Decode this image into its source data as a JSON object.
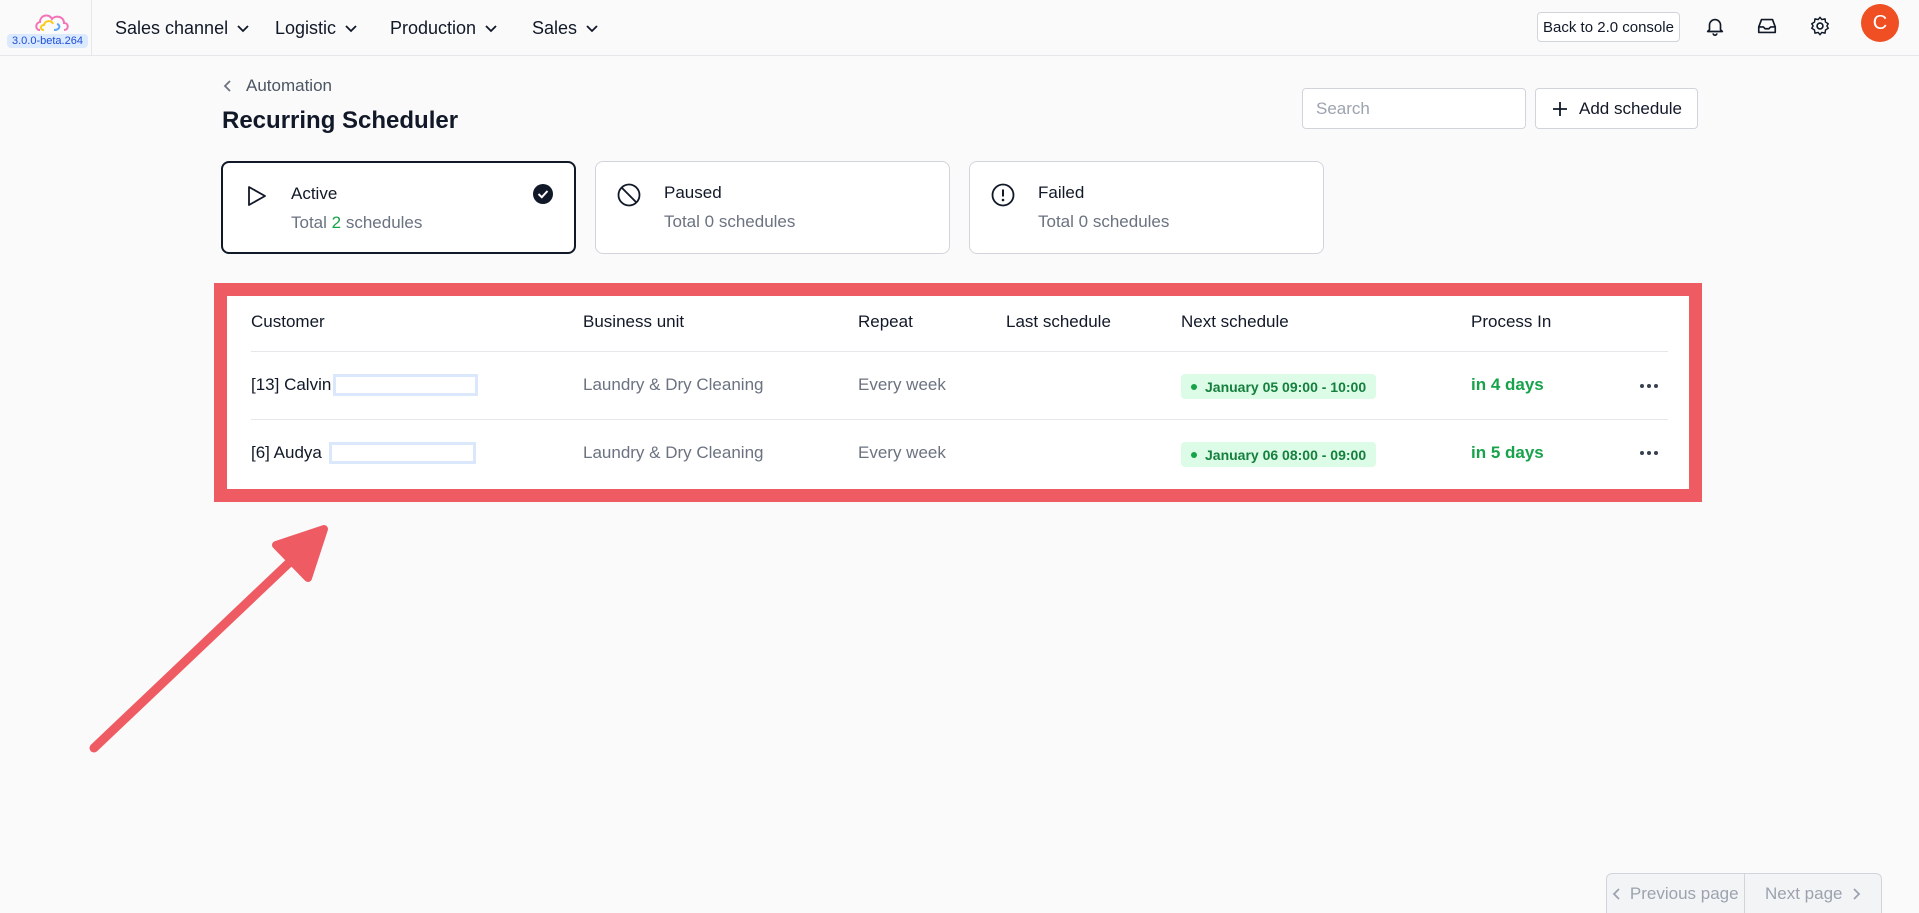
{
  "app": {
    "version": "3.0.0-beta.264",
    "brand_colors": [
      "#f472b6",
      "#facc15",
      "#60a5fa"
    ]
  },
  "nav": {
    "items": [
      {
        "label": "Sales channel"
      },
      {
        "label": "Logistic"
      },
      {
        "label": "Production"
      },
      {
        "label": "Sales"
      }
    ],
    "back_button": "Back to 2.0 console",
    "icons": [
      "bell-icon",
      "inbox-icon",
      "gear-icon"
    ],
    "avatar_initial": "C",
    "avatar_color": "#f04e23"
  },
  "header": {
    "breadcrumb": "Automation",
    "title": "Recurring Scheduler",
    "search_placeholder": "Search",
    "add_button": "Add schedule"
  },
  "status_cards": [
    {
      "title": "Active",
      "prefix": "Total ",
      "count": "2",
      "suffix": " schedules",
      "selected": true,
      "icon": "play-icon"
    },
    {
      "title": "Paused",
      "prefix": "Total ",
      "count": "0",
      "suffix": " schedules",
      "selected": false,
      "icon": "ban-icon"
    },
    {
      "title": "Failed",
      "prefix": "Total ",
      "count": "0",
      "suffix": " schedules",
      "selected": false,
      "icon": "alert-circle-icon"
    }
  ],
  "table": {
    "columns": [
      "Customer",
      "Business unit",
      "Repeat",
      "Last schedule",
      "Next schedule",
      "Process In"
    ],
    "rows": [
      {
        "customer": "[13] Calvin",
        "business_unit": "Laundry & Dry Cleaning",
        "repeat": "Every week",
        "last_schedule": "",
        "next_schedule": "January 05 09:00 - 10:00",
        "process_in": "in 4 days"
      },
      {
        "customer": "[6] Audya",
        "business_unit": "Laundry & Dry Cleaning",
        "repeat": "Every week",
        "last_schedule": "",
        "next_schedule": "January 06 08:00 - 09:00",
        "process_in": "in 5 days"
      }
    ]
  },
  "pagination": {
    "previous": "Previous page",
    "next": "Next page"
  },
  "colors": {
    "accent_green": "#16a34a",
    "annotation_red": "#ef5b63"
  }
}
